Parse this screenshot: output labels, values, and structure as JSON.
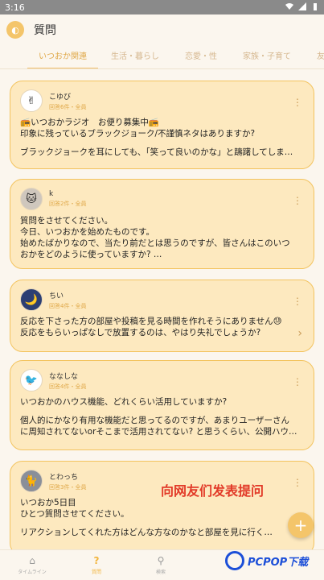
{
  "statusbar": {
    "time": "3:16"
  },
  "app": {
    "logo_glyph": "◐",
    "title": "質問"
  },
  "tabs": [
    "いつおか関連",
    "生活・暮らし",
    "恋愛・性",
    "家族・子育て",
    "友人・人"
  ],
  "cards": [
    {
      "avatar": "✌",
      "name": "こゆび",
      "meta": "回答6件・全員",
      "lines": [
        "📻いつおかラジオ　お便り募集中📻",
        "印象に残っているブラックジョーク/不謹慎ネタはありますか?",
        "",
        "ブラックジョークを耳にしても、「笑って良いのかな」と躊躇してしま…"
      ]
    },
    {
      "avatar": "🐱",
      "name": "k",
      "meta": "回答2件・全員",
      "lines": [
        "質問をさせてください。",
        "今日、いつおかを始めたものです。",
        "始めたばかりなので、当たり前だとは思うのですが、皆さんはこのいつ",
        "おかをどのように使っていますか? …"
      ]
    },
    {
      "avatar": "🌙",
      "name": "ちい",
      "meta": "回答4件・全員",
      "lines": [
        "反応を下さった方の部屋や投稿を見る時間を作れそうにありません😓",
        "反応をもらいっぱなしで放置するのは、やはり失礼でしょうか?"
      ]
    },
    {
      "avatar": "🐦",
      "name": "ななしな",
      "meta": "回答4件・全員",
      "lines": [
        "いつおかのハウス機能、どれくらい活用していますか?",
        "",
        "個人的にかなり有用な機能だと思ってるのですが、あまりユーザーさん",
        "に周知されてないorそこまで活用されてない? と思うくらい、公開ハウ…"
      ]
    },
    {
      "avatar": "🐈",
      "name": "とわっち",
      "meta": "回答3件・全員",
      "lines": [
        "いつおか5日目",
        "ひとつ質問させてください。",
        "",
        "リアクションしてくれた方はどんな方なのかなと部屋を見に行くんで…"
      ]
    }
  ],
  "overlay_text": "向网友们发表提问",
  "fab": "+",
  "bottomnav": [
    {
      "icon": "⌂",
      "label": "タイムライン"
    },
    {
      "icon": "?",
      "label": "質問"
    },
    {
      "icon": "⚲",
      "label": "検索"
    },
    {
      "icon": "",
      "label": ""
    },
    {
      "icon": "",
      "label": ""
    }
  ],
  "watermark": {
    "text": "PCPOP下载"
  }
}
